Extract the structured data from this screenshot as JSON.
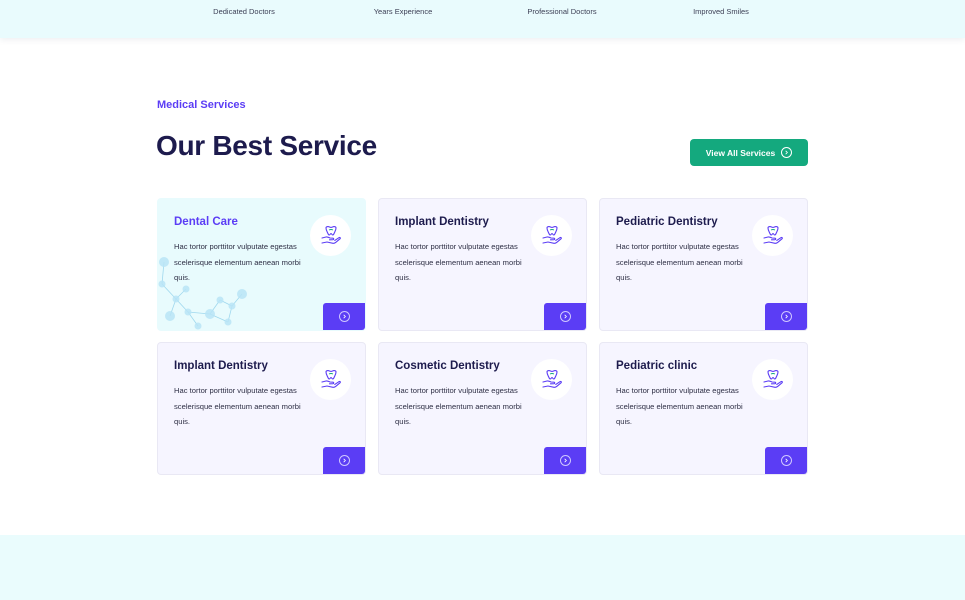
{
  "stats": {
    "labels": [
      "Dedicated Doctors",
      "Years Experience",
      "Professional Doctors",
      "Improved Smiles"
    ]
  },
  "services": {
    "eyebrow": "Medical Services",
    "title": "Our Best Service",
    "view_all_label": "View All Services",
    "cards": [
      {
        "title": "Dental Care",
        "description": "Hac tortor porttitor vulputate egestas scelerisque elementum aenean morbi quis.",
        "active": true
      },
      {
        "title": "Implant Dentistry",
        "description": "Hac tortor porttitor vulputate egestas scelerisque elementum aenean morbi quis.",
        "active": false
      },
      {
        "title": "Pediatric Dentistry",
        "description": "Hac tortor porttitor vulputate egestas scelerisque elementum aenean morbi quis.",
        "active": false
      },
      {
        "title": "Implant Dentistry",
        "description": "Hac tortor porttitor vulputate egestas scelerisque elementum aenean morbi quis.",
        "active": false
      },
      {
        "title": "Cosmetic Dentistry",
        "description": "Hac tortor porttitor vulputate egestas scelerisque elementum aenean morbi quis.",
        "active": false
      },
      {
        "title": "Pediatric clinic",
        "description": "Hac tortor porttitor vulputate egestas scelerisque elementum aenean morbi quis.",
        "active": false
      }
    ]
  },
  "icons": {
    "service_icon": "tooth-in-hand-icon",
    "card_button_icon": "arrow-circle-icon",
    "view_all_icon": "arrow-circle-icon",
    "decoration": "molecule-pattern"
  },
  "colors": {
    "accent_purple": "#5b3df5",
    "accent_green": "#14a97e",
    "heading_navy": "#1d1b4d",
    "highlight_bg": "#e8fbfd",
    "card_bg": "#f6f5ff"
  }
}
